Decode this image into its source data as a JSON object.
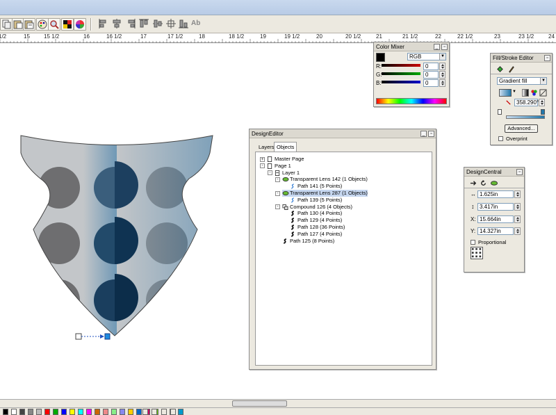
{
  "ruler": {
    "labels": [
      "1/2",
      "15",
      "15 1/2",
      "16",
      "16 1/2",
      "17",
      "17 1/2",
      "18",
      "18 1/2",
      "19",
      "19 1/2",
      "20",
      "20 1/2",
      "21",
      "21 1/2",
      "22",
      "22 1/2",
      "23",
      "23 1/2",
      "24"
    ]
  },
  "colorMixer": {
    "title": "Color Mixer",
    "model": "RGB",
    "channels": [
      {
        "label": "R:",
        "value": "0",
        "color": "#cc0000"
      },
      {
        "label": "G:",
        "value": "0",
        "color": "#00aa00"
      },
      {
        "label": "B:",
        "value": "0",
        "color": "#0000cc"
      }
    ]
  },
  "fillStroke": {
    "title": "Fill/Stroke Editor",
    "fillType": "Gradient fill",
    "angle": "358.290°",
    "advanced": "Advanced...",
    "overprint": "Overprint"
  },
  "designEditor": {
    "title": "DesignEditor",
    "tabs": [
      "Layers",
      "Objects"
    ],
    "tree": [
      {
        "label": "Master Page",
        "indent": 0,
        "icon": "page-icon",
        "expander": "+"
      },
      {
        "label": "Page 1",
        "indent": 0,
        "icon": "page-icon",
        "expander": "-"
      },
      {
        "label": "Layer 1",
        "indent": 1,
        "icon": "layer-icon",
        "expander": "-"
      },
      {
        "label": "Transparent Lens 142 (1 Objects)",
        "indent": 2,
        "icon": "lens-icon",
        "expander": "-"
      },
      {
        "label": "Path 141 (5 Points)",
        "indent": 3,
        "icon": "path-icon",
        "expander": ""
      },
      {
        "label": "Transparent Lens 287 (1 Objects)",
        "indent": 2,
        "icon": "lens-icon",
        "expander": "-",
        "selected": true
      },
      {
        "label": "Path 139 (5 Points)",
        "indent": 3,
        "icon": "path-icon",
        "expander": ""
      },
      {
        "label": "Compound 126 (4 Objects)",
        "indent": 2,
        "icon": "compound-icon",
        "expander": "-"
      },
      {
        "label": "Path 130 (4 Points)",
        "indent": 3,
        "icon": "path-bold-icon",
        "expander": ""
      },
      {
        "label": "Path 129 (4 Points)",
        "indent": 3,
        "icon": "path-bold-icon",
        "expander": ""
      },
      {
        "label": "Path 128 (36 Points)",
        "indent": 3,
        "icon": "path-bold-icon",
        "expander": ""
      },
      {
        "label": "Path 127 (4 Points)",
        "indent": 3,
        "icon": "path-bold-icon",
        "expander": ""
      },
      {
        "label": "Path 125 (8 Points)",
        "indent": 2,
        "icon": "path-bold-icon",
        "expander": ""
      }
    ]
  },
  "designCentral": {
    "title": "DesignCentral",
    "width": "1.625in",
    "height": "3.417in",
    "x": "15.664in",
    "y": "14.327in",
    "xLabel": "X:",
    "yLabel": "Y:",
    "proportional": "Proportional"
  },
  "colors": {
    "accent": "#1f5f95",
    "panelBg": "#ece9e0"
  }
}
